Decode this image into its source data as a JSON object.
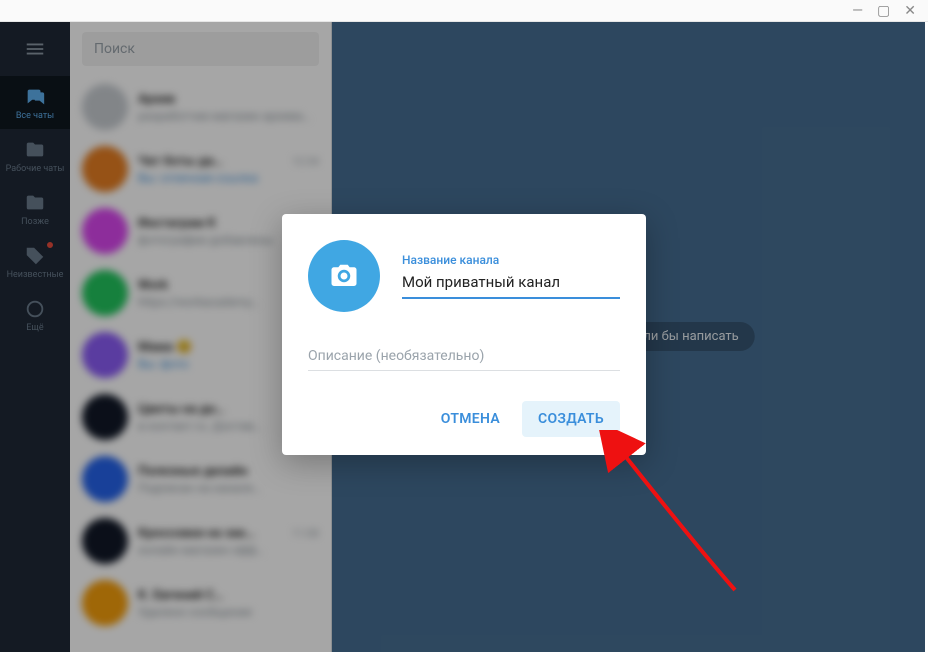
{
  "window": {
    "minimize": "—",
    "maximize": "▢",
    "close": "✕"
  },
  "rail": {
    "items": [
      {
        "name": "all-chats",
        "label": "Все чаты",
        "active": true
      },
      {
        "name": "work",
        "label": "Рабочие чаты"
      },
      {
        "name": "later",
        "label": "Позже"
      },
      {
        "name": "unknown",
        "label": "Неизвестные",
        "badge": true
      },
      {
        "name": "settings",
        "label": "Ещё"
      }
    ]
  },
  "search": {
    "placeholder": "Поиск"
  },
  "chats": [
    {
      "color": "#c8cdd2",
      "title": "Архив",
      "sub": "разработчик-магазин архива…"
    },
    {
      "color": "#e67e22",
      "title": "Чат боты да…",
      "sub": "Вы: отличная ссылка",
      "time": "12:34",
      "you": true
    },
    {
      "color": "#d946ef",
      "title": "Инстаграм К",
      "sub": "фотографии добавлены"
    },
    {
      "color": "#22c55e",
      "title": "Work",
      "sub": "https://workacademy…"
    },
    {
      "color": "#8b5cf6",
      "title": "Мама 😊",
      "sub": "Вы: фото",
      "you": true
    },
    {
      "color": "#111827",
      "title": "Цветы на дн…",
      "sub": "в контакт.ru. Достав…"
    },
    {
      "color": "#2563eb",
      "title": "Полезные дизайн",
      "sub": "Подписан на канале…"
    },
    {
      "color": "#111827",
      "title": "Кроссовки на зак…",
      "sub": "онлайн магазин офф…",
      "time": "11:08"
    },
    {
      "color": "#f59e0b",
      "title": "K. Евгений С…",
      "sub": "Удалено сообщение"
    }
  ],
  "main": {
    "hint": "Выберите, кому хотели бы написать"
  },
  "modal": {
    "name_label": "Название канала",
    "name_value": "Мой приватный канал",
    "desc_placeholder": "Описание (необязательно)",
    "cancel": "ОТМЕНА",
    "create": "СОЗДАТЬ"
  },
  "colors": {
    "accent": "#3a8edb",
    "rail_bg": "#1f2937",
    "main_bg": "#466e92"
  }
}
